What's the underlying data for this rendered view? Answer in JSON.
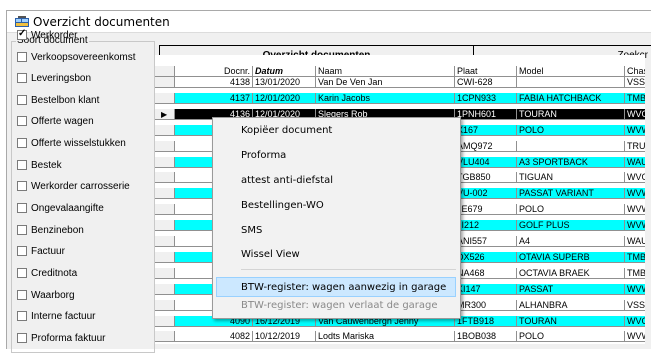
{
  "window": {
    "title": "Overzicht documenten"
  },
  "sidebar": {
    "legend": "Soort document",
    "items": [
      {
        "label": "Werkorder",
        "checked": true
      },
      {
        "label": "Verkoopsovereenkomst",
        "checked": false
      },
      {
        "label": "Leveringsbon",
        "checked": false
      },
      {
        "label": "Bestelbon klant",
        "checked": false
      },
      {
        "label": "Offerte wagen",
        "checked": false
      },
      {
        "label": "Offerte wisselstukken",
        "checked": false
      },
      {
        "label": "Bestek",
        "checked": false
      },
      {
        "label": "Werkorder carrosserie",
        "checked": false
      },
      {
        "label": "Ongevalaangifte",
        "checked": false
      },
      {
        "label": "Benzinebon",
        "checked": false
      },
      {
        "label": "Factuur",
        "checked": false
      },
      {
        "label": "Creditnota",
        "checked": false
      },
      {
        "label": "Waarborg",
        "checked": false
      },
      {
        "label": "Interne factuur",
        "checked": false
      },
      {
        "label": "Proforma faktuur",
        "checked": false
      }
    ]
  },
  "tabs": {
    "main": "Overzicht documenten",
    "right": "Zoekcr"
  },
  "grid": {
    "columns": [
      "Docnr.",
      "Datum",
      "Naam",
      "Plaat",
      "Model",
      "Chass"
    ],
    "rows": [
      {
        "style": "white",
        "cells": [
          "4138",
          "13/01/2020",
          "Van De Ven Jan",
          "CWI-628",
          "",
          "VSSZ"
        ]
      },
      {
        "style": "cyan",
        "cells": [
          "4137",
          "12/01/2020",
          "Karin Jacobs",
          "1CPN933",
          "FABIA HATCHBACK",
          "TMBE"
        ]
      },
      {
        "style": "black",
        "cells": [
          "4136",
          "12/01/2020",
          "Slegers Rob",
          "1PNH601",
          "TOURAN",
          "WVGZ"
        ],
        "current": true
      },
      {
        "style": "cyan",
        "cells": [
          "",
          "",
          "",
          "X167",
          "POLO",
          "WVW"
        ]
      },
      {
        "style": "white",
        "cells": [
          "",
          "",
          "",
          "AMQ972",
          "",
          "TRUZ"
        ]
      },
      {
        "style": "cyan",
        "cells": [
          "",
          "",
          "",
          "VLU404",
          "A3 SPORTBACK",
          "WAUZ"
        ]
      },
      {
        "style": "white",
        "cells": [
          "",
          "",
          "",
          "TGB850",
          "TIGUAN",
          "WVGZ"
        ]
      },
      {
        "style": "cyan",
        "cells": [
          "",
          "",
          "",
          "VU-002",
          "PASSAT VARIANT",
          "WVW"
        ]
      },
      {
        "style": "white",
        "cells": [
          "",
          "",
          "",
          "JE679",
          "POLO",
          "WVW"
        ]
      },
      {
        "style": "cyan",
        "cells": [
          "",
          "",
          "",
          "JI212",
          "GOLF PLUS",
          "WVW"
        ]
      },
      {
        "style": "white",
        "cells": [
          "",
          "",
          "",
          "ANI557",
          "A4",
          "WAUZ"
        ]
      },
      {
        "style": "cyan",
        "cells": [
          "",
          "",
          "",
          "DX526",
          "OTAVIA SUPERB",
          "TMBJ"
        ]
      },
      {
        "style": "white",
        "cells": [
          "",
          "",
          "",
          "NA468",
          "OCTAVIA BRAEK",
          "TMBH"
        ]
      },
      {
        "style": "cyan",
        "cells": [
          "",
          "",
          "",
          "KI147",
          "PASSAT",
          "WVW"
        ]
      },
      {
        "style": "white",
        "cells": [
          "",
          "",
          "",
          "MR300",
          "ALHANBRA",
          "VSSZ"
        ]
      },
      {
        "style": "cyan",
        "cells": [
          "4090",
          "16/12/2019",
          "Van Cauwenbergh Jenny",
          "1FTB918",
          "TOURAN",
          "WVGZ"
        ]
      },
      {
        "style": "white",
        "cells": [
          "4082",
          "10/12/2019",
          "Lodts Mariska",
          "1BOB038",
          "POLO",
          "WVW"
        ]
      }
    ]
  },
  "context_menu": {
    "items": [
      {
        "label": "Kopiëer document",
        "state": "normal"
      },
      {
        "label": "Proforma",
        "state": "normal"
      },
      {
        "label": "attest anti-diefstal",
        "state": "normal"
      },
      {
        "label": "Bestellingen-WO",
        "state": "normal"
      },
      {
        "label": "SMS",
        "state": "normal"
      },
      {
        "label": "Wissel View",
        "state": "normal"
      },
      {
        "label": "BTW-register: wagen aanwezig in garage",
        "state": "highlighted"
      },
      {
        "label": "BTW-register: wagen verlaat de garage",
        "state": "disabled"
      }
    ]
  },
  "colors": {
    "cyan_row": "#00ffff",
    "selected_row": "#000000",
    "menu_highlight": "#cce8ff"
  },
  "icons": {
    "window_icon": "app-icon",
    "row_indicator": "right-triangle"
  }
}
